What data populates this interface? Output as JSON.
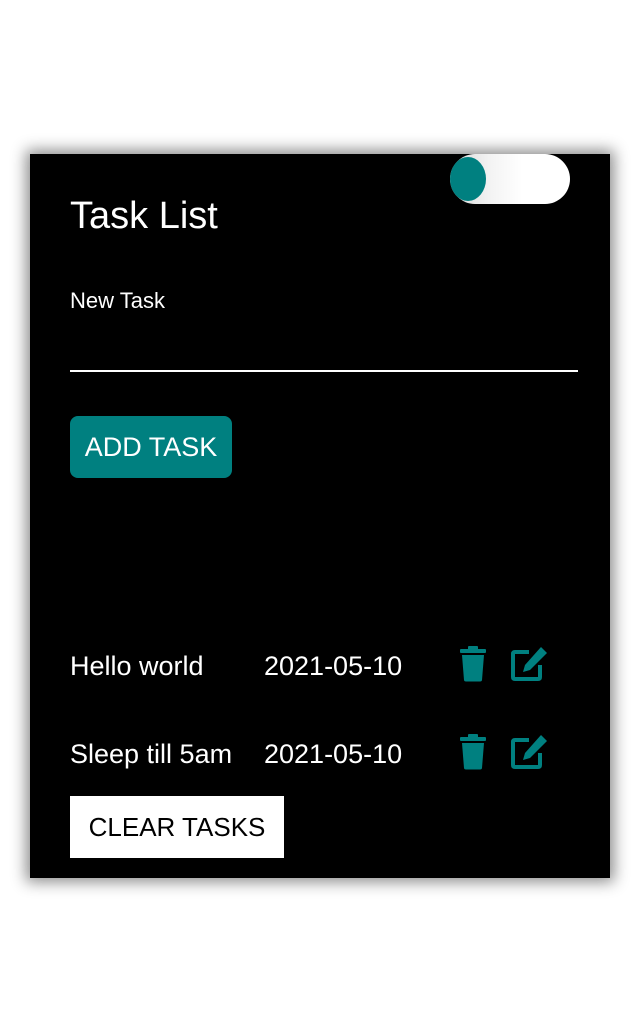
{
  "theme": {
    "accent": "#008080",
    "background": "#000000",
    "text": "#ffffff"
  },
  "toggle": {
    "icon": "theme-toggle"
  },
  "header": {
    "title": "Task List"
  },
  "form": {
    "label": "New Task",
    "value": "",
    "add_label": "ADD TASK"
  },
  "tasks": [
    {
      "name": "Hello world",
      "date": "2021-05-10",
      "delete_icon": "trash-icon",
      "edit_icon": "edit-icon"
    },
    {
      "name": "Sleep till 5am",
      "date": "2021-05-10",
      "delete_icon": "trash-icon",
      "edit_icon": "edit-icon"
    }
  ],
  "footer": {
    "clear_label": "CLEAR TASKS"
  }
}
